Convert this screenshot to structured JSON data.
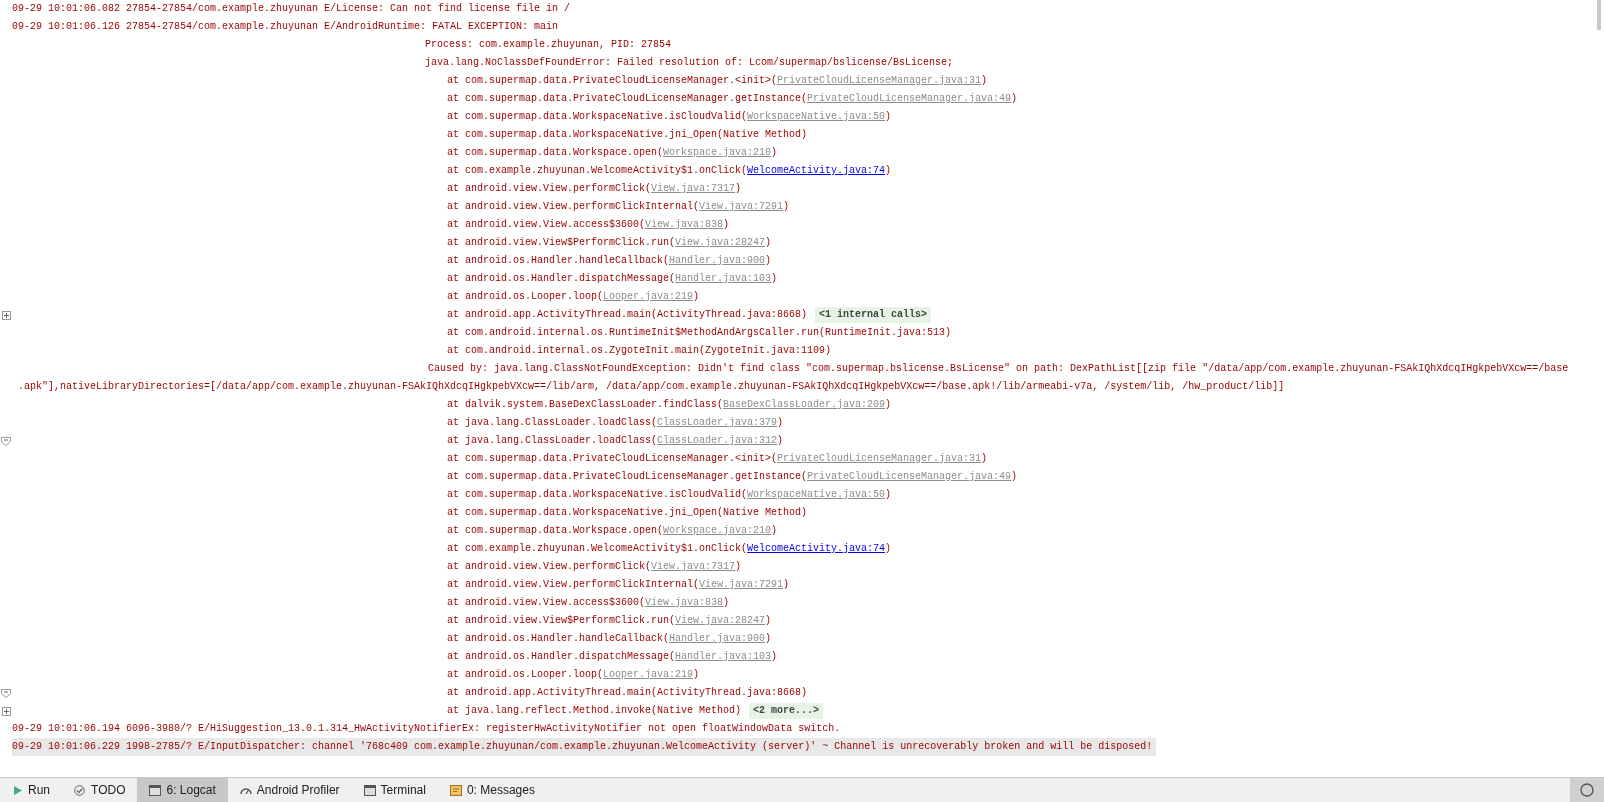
{
  "log_lines": [
    {
      "kind": "header",
      "text": "09-29 10:01:06.082 27854-27854/com.example.zhuyunan E/License: Can not find license file in /",
      "selected": false
    },
    {
      "kind": "header",
      "text": "09-29 10:01:06.126 27854-27854/com.example.zhuyunan E/AndroidRuntime: FATAL EXCEPTION: main",
      "selected": false
    },
    {
      "kind": "detail",
      "text": "Process: com.example.zhuyunan, PID: 27854",
      "selected": false
    },
    {
      "kind": "detail",
      "text": "java.lang.NoClassDefFoundError: Failed resolution of: Lcom/supermap/bslicense/BsLicense;",
      "selected": false
    },
    {
      "kind": "frame",
      "text": "at com.supermap.data.PrivateCloudLicenseManager.<init>(",
      "link": "PrivateCloudLicenseManager.java:31",
      "in_project": false,
      "after": ")",
      "selected": false
    },
    {
      "kind": "frame",
      "text": "at com.supermap.data.PrivateCloudLicenseManager.getInstance(",
      "link": "PrivateCloudLicenseManager.java:49",
      "in_project": false,
      "after": ")",
      "selected": false
    },
    {
      "kind": "frame",
      "text": "at com.supermap.data.WorkspaceNative.isCloudValid(",
      "link": "WorkspaceNative.java:50",
      "in_project": false,
      "after": ")",
      "selected": false
    },
    {
      "kind": "frame",
      "text": "at com.supermap.data.WorkspaceNative.jni_Open(Native Method)",
      "selected": false
    },
    {
      "kind": "frame",
      "text": "at com.supermap.data.Workspace.open(",
      "link": "Workspace.java:210",
      "in_project": false,
      "after": ")",
      "selected": false
    },
    {
      "kind": "frame",
      "text": "at com.example.zhuyunan.WelcomeActivity$1.onClick(",
      "link": "WelcomeActivity.java:74",
      "in_project": true,
      "after": ")",
      "selected": false
    },
    {
      "kind": "frame",
      "text": "at android.view.View.performClick(",
      "link": "View.java:7317",
      "in_project": false,
      "after": ")",
      "selected": false
    },
    {
      "kind": "frame",
      "text": "at android.view.View.performClickInternal(",
      "link": "View.java:7291",
      "in_project": false,
      "after": ")",
      "selected": false
    },
    {
      "kind": "frame",
      "text": "at android.view.View.access$3600(",
      "link": "View.java:838",
      "in_project": false,
      "after": ")",
      "selected": false
    },
    {
      "kind": "frame",
      "text": "at android.view.View$PerformClick.run(",
      "link": "View.java:28247",
      "in_project": false,
      "after": ")",
      "selected": false
    },
    {
      "kind": "frame",
      "text": "at android.os.Handler.handleCallback(",
      "link": "Handler.java:900",
      "in_project": false,
      "after": ")",
      "selected": false
    },
    {
      "kind": "frame",
      "text": "at android.os.Handler.dispatchMessage(",
      "link": "Handler.java:103",
      "in_project": false,
      "after": ")",
      "selected": false
    },
    {
      "kind": "frame",
      "text": "at android.os.Looper.loop(",
      "link": "Looper.java:219",
      "in_project": false,
      "after": ")",
      "selected": false
    },
    {
      "kind": "frame",
      "text": "at android.app.ActivityThread.main(ActivityThread.java:8668)",
      "folded": "<1 internal calls>",
      "expanded": false,
      "selected": false
    },
    {
      "kind": "frame",
      "text": "at com.android.internal.os.RuntimeInit$MethodAndArgsCaller.run(RuntimeInit.java:513)",
      "selected": false
    },
    {
      "kind": "frame",
      "text": "at com.android.internal.os.ZygoteInit.main(ZygoteInit.java:1109)",
      "selected": false
    },
    {
      "kind": "cause",
      "text": "Caused by: java.lang.ClassNotFoundException: Didn't find class \"com.supermap.bslicense.BsLicense\" on path: DexPathList[[zip file \"/data/app/com.example.zhuyunan-FSAkIQhXdcqIHgkpebVXcw==/base",
      "selected": false
    },
    {
      "kind": "wrap",
      "text": ".apk\"],nativeLibraryDirectories=[/data/app/com.example.zhuyunan-FSAkIQhXdcqIHgkpebVXcw==/lib/arm, /data/app/com.example.zhuyunan-FSAkIQhXdcqIHgkpebVXcw==/base.apk!/lib/armeabi-v7a, /system/lib, /hw_product/lib]]",
      "selected": false
    },
    {
      "kind": "frame",
      "text": "at dalvik.system.BaseDexClassLoader.findClass(",
      "link": "BaseDexClassLoader.java:209",
      "in_project": false,
      "after": ")",
      "selected": false
    },
    {
      "kind": "frame",
      "text": "at java.lang.ClassLoader.loadClass(",
      "link": "ClassLoader.java:379",
      "in_project": false,
      "after": ")",
      "selected": false
    },
    {
      "kind": "frame",
      "text": "at java.lang.ClassLoader.loadClass(",
      "link": "ClassLoader.java:312",
      "in_project": false,
      "after": ")",
      "expanded": true,
      "selected": false
    },
    {
      "kind": "frame",
      "text": "at com.supermap.data.PrivateCloudLicenseManager.<init>(",
      "link": "PrivateCloudLicenseManager.java:31",
      "in_project": false,
      "after": ")",
      "selected": false
    },
    {
      "kind": "frame",
      "text": "at com.supermap.data.PrivateCloudLicenseManager.getInstance(",
      "link": "PrivateCloudLicenseManager.java:49",
      "in_project": false,
      "after": ")",
      "selected": false
    },
    {
      "kind": "frame",
      "text": "at com.supermap.data.WorkspaceNative.isCloudValid(",
      "link": "WorkspaceNative.java:50",
      "in_project": false,
      "after": ")",
      "selected": false
    },
    {
      "kind": "frame",
      "text": "at com.supermap.data.WorkspaceNative.jni_Open(Native Method)",
      "selected": false
    },
    {
      "kind": "frame",
      "text": "at com.supermap.data.Workspace.open(",
      "link": "Workspace.java:210",
      "in_project": false,
      "after": ")",
      "selected": false
    },
    {
      "kind": "frame",
      "text": "at com.example.zhuyunan.WelcomeActivity$1.onClick(",
      "link": "WelcomeActivity.java:74",
      "in_project": true,
      "after": ")",
      "selected": false
    },
    {
      "kind": "frame",
      "text": "at android.view.View.performClick(",
      "link": "View.java:7317",
      "in_project": false,
      "after": ")",
      "selected": false
    },
    {
      "kind": "frame",
      "text": "at android.view.View.performClickInternal(",
      "link": "View.java:7291",
      "in_project": false,
      "after": ")",
      "selected": false
    },
    {
      "kind": "frame",
      "text": "at android.view.View.access$3600(",
      "link": "View.java:838",
      "in_project": false,
      "after": ")",
      "selected": false
    },
    {
      "kind": "frame",
      "text": "at android.view.View$PerformClick.run(",
      "link": "View.java:28247",
      "in_project": false,
      "after": ")",
      "selected": false
    },
    {
      "kind": "frame",
      "text": "at android.os.Handler.handleCallback(",
      "link": "Handler.java:900",
      "in_project": false,
      "after": ")",
      "selected": false
    },
    {
      "kind": "frame",
      "text": "at android.os.Handler.dispatchMessage(",
      "link": "Handler.java:103",
      "in_project": false,
      "after": ")",
      "selected": false
    },
    {
      "kind": "frame",
      "text": "at android.os.Looper.loop(",
      "link": "Looper.java:219",
      "in_project": false,
      "after": ")",
      "selected": false
    },
    {
      "kind": "frame",
      "text": "at android.app.ActivityThread.main(ActivityThread.java:8668)",
      "expanded": true,
      "selected": false
    },
    {
      "kind": "frame",
      "text": "at java.lang.reflect.Method.invoke(Native Method)",
      "folded": "<2 more...>",
      "expanded": false,
      "selected": false
    },
    {
      "kind": "header",
      "text": "09-29 10:01:06.194 6096-3980/? E/HiSuggestion_13.0.1.314_HwActivityNotifierEx: registerHwActivityNotifier not open floatWindowData switch.",
      "selected": false
    },
    {
      "kind": "header",
      "text": "09-29 10:01:06.229 1998-2785/? E/InputDispatcher: channel '768c409 com.example.zhuyunan/com.example.zhuyunan.WelcomeActivity (server)' ~ Channel is unrecoverably broken and will be disposed!",
      "selected": true
    }
  ],
  "tool_tabs": [
    {
      "label": "Run",
      "selected": false
    },
    {
      "label": "TODO",
      "selected": false
    },
    {
      "label": "6: Logcat",
      "selected": true
    },
    {
      "label": "Android Profiler",
      "selected": false
    },
    {
      "label": "Terminal",
      "selected": false
    },
    {
      "label": "0: Messages",
      "selected": false
    }
  ]
}
